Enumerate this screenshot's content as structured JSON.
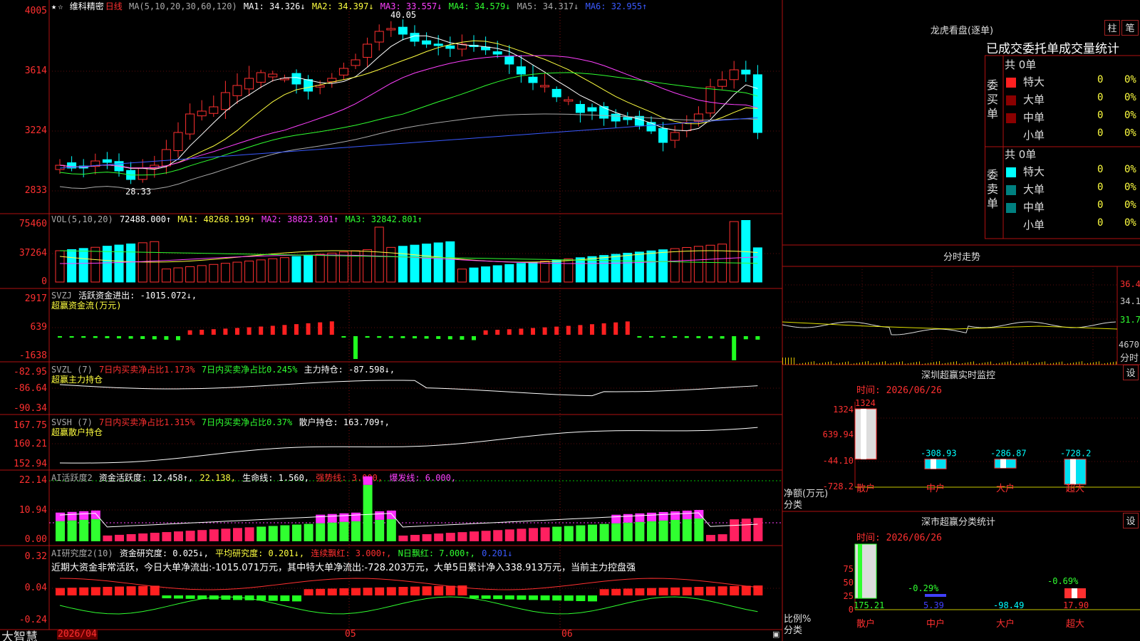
{
  "app": {
    "brand": "大智慧"
  },
  "stock": {
    "name": "维科精密",
    "period": "日线"
  },
  "main": {
    "ma_title": "MA(5,10,20,30,60,120)",
    "ma1": "MA1: 34.326↓",
    "ma2": "MA2: 34.397↓",
    "ma3": "MA3: 33.557↓",
    "ma4": "MA4: 34.579↓",
    "ma5": "MA5: 34.317↓",
    "ma6": "MA6: 32.955↑",
    "y_ticks": [
      "4005",
      "3614",
      "3224",
      "2833"
    ],
    "high_label": "40.05",
    "low_label": "28.33"
  },
  "vol": {
    "title": "VOL(5,10,20)",
    "value": "72488.000↑",
    "ma1": "MA1: 48268.199↑",
    "ma2": "MA2: 38823.301↑",
    "ma3": "MA3: 32842.801↑",
    "y_ticks": [
      "75460",
      "37264",
      "0"
    ]
  },
  "svzj": {
    "title": "SVZJ",
    "label": "活跃资金进出: -1015.072↓,",
    "subtitle": "超赢资金流(万元)",
    "y_ticks": [
      "2917",
      "639",
      "-1638"
    ]
  },
  "svzl": {
    "title": "SVZL (7)",
    "a": "7日内买卖净占比1.173%",
    "b": "7日内买卖净占比0.245%",
    "c": "主力持仓: -87.598↓,",
    "subtitle": "超赢主力持仓",
    "y_ticks": [
      "-82.95",
      "-86.64",
      "-90.34"
    ]
  },
  "svsh": {
    "title": "SVSH (7)",
    "a": "7日内买卖净占比1.315%",
    "b": "7日内买卖净占比0.37%",
    "c": "散户持仓: 163.709↑,",
    "subtitle": "超赢散户持仓",
    "y_ticks": [
      "167.75",
      "160.21",
      "152.94"
    ]
  },
  "ai1": {
    "title": "AI活跃度2",
    "a": "资金活跃度: 12.458↑,",
    "b": "22.138,",
    "c": "生命线: 1.560,",
    "d": "强势线: 3.000,",
    "e": "爆发线: 6.000,",
    "y_ticks": [
      "22.14",
      "10.94",
      "0.00"
    ]
  },
  "ai2": {
    "title": "AI研究度2(10)",
    "a": "资金研究度: 0.025↓,",
    "b": "平均研究度: 0.201↓,",
    "c": "连续飘红: 3.000↑,",
    "d": "N日飘红: 7.000↑,",
    "e": "0.201↓",
    "note": "近期大资金非常活跃，今日大单净流出:-1015.071万元，其中特大单净流出:-728.203万元，大单5日累计净入338.913万元，当前主力控盘强",
    "y_ticks": [
      "0.32",
      "0.04",
      "-0.24"
    ]
  },
  "xaxis": {
    "date": "2026/04",
    "m5": "05",
    "m6": "06"
  },
  "dragon": {
    "title": "龙虎看盘(逐单)",
    "btn1": "柱",
    "btn2": "笔",
    "tabs": "已成交委托单成交量统计",
    "buy_label": "委买单",
    "sell_label": "委卖单",
    "buy_total": "共 0单",
    "sell_total": "共 0单",
    "rows": [
      {
        "name": "特大",
        "n": "0",
        "p": "0%"
      },
      {
        "name": "大单",
        "n": "0",
        "p": "0%"
      },
      {
        "name": "中单",
        "n": "0",
        "p": "0%"
      },
      {
        "name": "小单",
        "n": "0",
        "p": "0%"
      }
    ]
  },
  "intraday": {
    "title": "分时走势",
    "ticks": [
      "36.40",
      "34.10",
      "31.74",
      "4670",
      "分时"
    ]
  },
  "monitor": {
    "title": "深圳超赢实时监控",
    "set": "设",
    "time": "时间: 2026/06/26",
    "y_ticks": [
      "1324",
      "639.94",
      "-44.10",
      "-728.2"
    ],
    "ylabel1": "净额(万元)",
    "ylabel2": "分类",
    "cats": [
      "散户",
      "中户",
      "大户",
      "超大"
    ],
    "values": [
      1324,
      -308.93,
      -286.87,
      -728.2
    ],
    "labels": [
      "1324",
      "-308.93",
      "-286.87",
      "-728.2"
    ]
  },
  "stats": {
    "title": "深市超赢分类统计",
    "set": "设",
    "time": "时间: 2026/06/26",
    "y_ticks": [
      "75",
      "50",
      "25",
      "0"
    ],
    "ylabel1": "比例%",
    "ylabel2": "分类",
    "cats": [
      "散户",
      "中户",
      "大户",
      "超大"
    ],
    "bottom_vals": [
      "175.21",
      "5.39",
      "-98.49",
      "17.90"
    ],
    "pct_labels": [
      "-0.29%",
      "-0.69%"
    ]
  },
  "chart_data": [
    {
      "type": "bar",
      "title": "深圳超赢实时监控",
      "ylabel": "净额(万元)",
      "categories": [
        "散户",
        "中户",
        "大户",
        "超大"
      ],
      "values": [
        1324,
        -308.93,
        -286.87,
        -728.2
      ],
      "ylim": [
        -728.2,
        1324
      ]
    },
    {
      "type": "bar",
      "title": "深市超赢分类统计",
      "ylabel": "比例%",
      "categories": [
        "散户",
        "中户",
        "大户",
        "超大"
      ],
      "values": [
        175.21,
        5.39,
        -98.49,
        17.9
      ],
      "ylim": [
        0,
        75
      ]
    }
  ]
}
